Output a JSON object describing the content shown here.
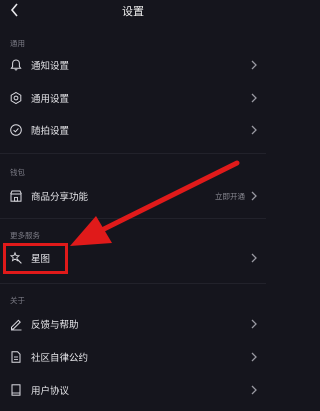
{
  "header": {
    "title": "设置",
    "back_icon": "chevron-left-icon"
  },
  "sections": {
    "general": {
      "label": "通用",
      "items": [
        {
          "label": "通知设置",
          "icon": "bell-icon"
        },
        {
          "label": "通用设置",
          "icon": "gear-icon"
        },
        {
          "label": "随拍设置",
          "icon": "checkmark-circle-icon"
        }
      ]
    },
    "wallet": {
      "label": "钱包",
      "items": [
        {
          "label": "商品分享功能",
          "extra": "立即开通",
          "icon": "shop-icon"
        }
      ]
    },
    "more_services": {
      "label": "更多服务",
      "items": [
        {
          "label": "星图",
          "icon": "star-wand-icon"
        }
      ]
    },
    "about": {
      "label": "关于",
      "items": [
        {
          "label": "反馈与帮助",
          "icon": "pencil-icon"
        },
        {
          "label": "社区自律公约",
          "icon": "document-icon"
        },
        {
          "label": "用户协议",
          "icon": "book-icon"
        }
      ]
    }
  },
  "annotation": {
    "highlight_color": "#e01a1a",
    "target": "星图"
  },
  "colors": {
    "background": "#15151d",
    "text": "#e6e6ea",
    "section_label": "#7c7c86",
    "accent_red": "#e01a1a"
  }
}
